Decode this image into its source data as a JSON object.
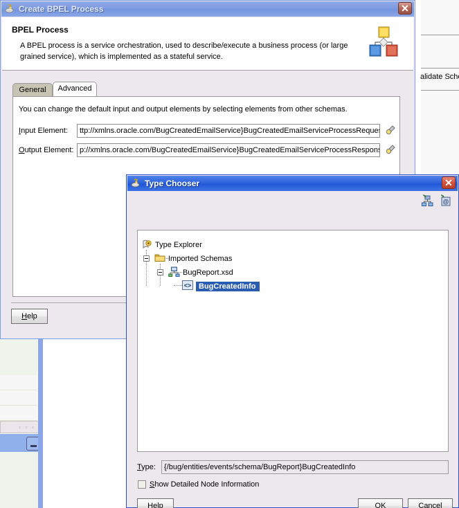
{
  "background": {
    "editor_text": "alidate Schen",
    "split_color": "#8ba6e8",
    "panel_green": "#eef4ec",
    "collapse_arrows": "‹ ‹ ‹"
  },
  "bpel_dialog": {
    "title": "Create BPEL Process",
    "title_icon": "bpel-lamp-icon",
    "close_label": "✕",
    "header": {
      "heading": "BPEL Process",
      "description": "A BPEL process is a service orchestration, used to describe/execute a business process (or large grained service), which is implemented as a stateful service.",
      "icon": "bpel-process-diagram-icon"
    },
    "tabs": [
      {
        "label": "General",
        "active": false
      },
      {
        "label": "Advanced",
        "active": true
      }
    ],
    "panel": {
      "note": "You can change the default input and output elements by selecting elements from other schemas.",
      "fields": [
        {
          "label": "Input Element:",
          "accesskey": "I",
          "value": "ttp://xmlns.oracle.com/BugCreatedEmailService}BugCreatedEmailServiceProcessRequest",
          "browse_icon": "browse-flashlight-icon"
        },
        {
          "label": "Output Element:",
          "accesskey": "O",
          "value": "p://xmlns.oracle.com/BugCreatedEmailService}BugCreatedEmailServiceProcessResponse",
          "browse_icon": "browse-flashlight-icon"
        }
      ]
    },
    "help_label": "Help",
    "help_accesskey": "H"
  },
  "type_chooser": {
    "title": "Type Chooser",
    "title_icon": "type-chooser-lamp-icon",
    "close_label": "✕",
    "toolbar": [
      {
        "name": "show-type-hierarchy-icon"
      },
      {
        "name": "import-schema-icon"
      }
    ],
    "tree": [
      {
        "label": "Type Explorer",
        "icon": "type-explorer-icon",
        "depth": 0,
        "selected": false,
        "expander": "none"
      },
      {
        "label": "Imported Schemas",
        "icon": "folder-icon",
        "depth": 1,
        "selected": false,
        "expander": "minus"
      },
      {
        "label": "BugReport.xsd",
        "icon": "schema-icon",
        "depth": 2,
        "selected": false,
        "expander": "minus"
      },
      {
        "label": "BugCreatedInfo",
        "icon": "element-brackets-icon",
        "depth": 3,
        "selected": true,
        "expander": "none"
      }
    ],
    "type_field": {
      "label": "Type:",
      "accesskey": "T",
      "value": "{/bug/entities/events/schema/BugReport}BugCreatedInfo"
    },
    "checkbox": {
      "label": "Show Detailed Node Information",
      "accesskey": "S",
      "checked": false
    },
    "buttons": {
      "help": "Help",
      "help_accesskey": "H",
      "ok": "OK",
      "cancel": "Cancel"
    }
  },
  "colors": {
    "title_active": "#2257d8",
    "title_inactive": "#7e9ce2",
    "dialog_face": "#ede8ee",
    "selection_blue": "#2a5db0",
    "close_red": "#c5402b"
  }
}
